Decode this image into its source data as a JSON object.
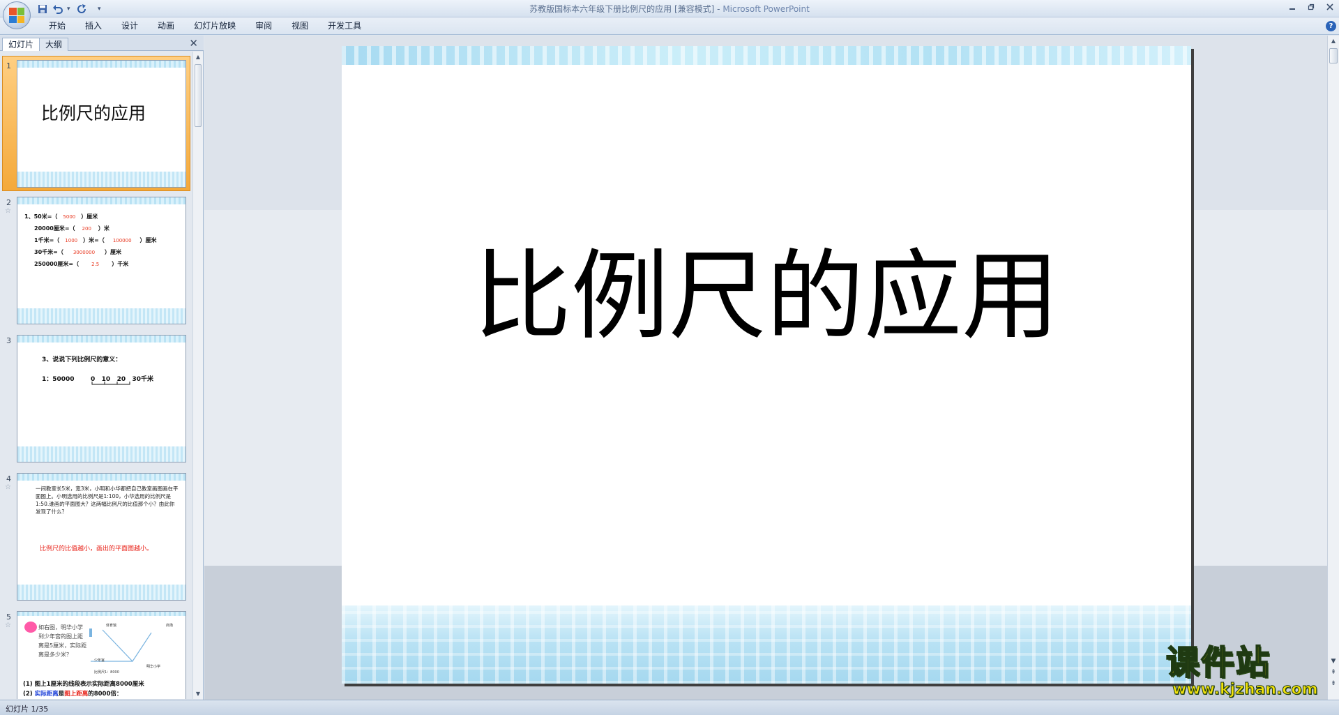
{
  "titlebar": {
    "document_title": "苏教版国标本六年级下册比例尺的应用 [兼容模式]",
    "separator": " - ",
    "app_name": "Microsoft PowerPoint"
  },
  "icons": {
    "office_button": "office-logo-icon",
    "save": "save-icon",
    "undo": "undo-icon",
    "redo": "redo-icon",
    "customize": "dropdown-icon",
    "minimize": "minimize-icon",
    "help": "help-icon"
  },
  "ribbon": {
    "tabs": [
      "开始",
      "插入",
      "设计",
      "动画",
      "幻灯片放映",
      "审阅",
      "视图",
      "开发工具"
    ],
    "help_glyph": "?"
  },
  "left_panel": {
    "tabs": [
      "幻灯片",
      "大纲"
    ],
    "close_glyph": "✕"
  },
  "thumbnails": [
    {
      "number": "1",
      "title": "比例尺的应用"
    },
    {
      "number": "2",
      "lines": [
        "1、50米=（",
        "）厘米",
        "20000厘米=（",
        "）米",
        "1千米=（",
        "）米=（",
        "）厘米",
        "30千米=（",
        "）厘米",
        "250000厘米=（",
        "）千米"
      ],
      "answers": [
        "5000",
        "200",
        "1000",
        "100000",
        "3000000",
        "2.5"
      ]
    },
    {
      "number": "3",
      "heading": "3、说说下列比例尺的意义：",
      "ratio": "1：50000",
      "scale": "0   10   20   30千米"
    },
    {
      "number": "4",
      "paragraph": "一间教室长5米，宽3米，小明和小华都把自己教室画图画在平面图上。小明选用的比例尺是1:100，小华选用的比例尺是1:50.谁画的平面图大？这两幅比例尺的比值那个小？由此你发现了什么？",
      "conclusion": "比例尺的比值越小，画出的平面图越小。"
    },
    {
      "number": "5",
      "text_lines": [
        "如右图，明华小学",
        "到少年宫的图上距",
        "离是5厘米，实际距",
        "离是多少米？"
      ],
      "map_labels": [
        "体育馆",
        "商场",
        "少年宫",
        "明华小学",
        "比例尺1：8000"
      ],
      "q1": "(1) 图上1厘米的线段表示实际距离8000厘米",
      "q2_parts": [
        "(2) ",
        "实际距离",
        "是",
        "图上距离",
        "的8000倍："
      ]
    }
  ],
  "slide": {
    "title": "比例尺的应用"
  },
  "watermark": {
    "main": "课件站",
    "url": "www.kjzhan.com"
  },
  "statusbar": {
    "slide_indicator": "幻灯片 1/35"
  }
}
